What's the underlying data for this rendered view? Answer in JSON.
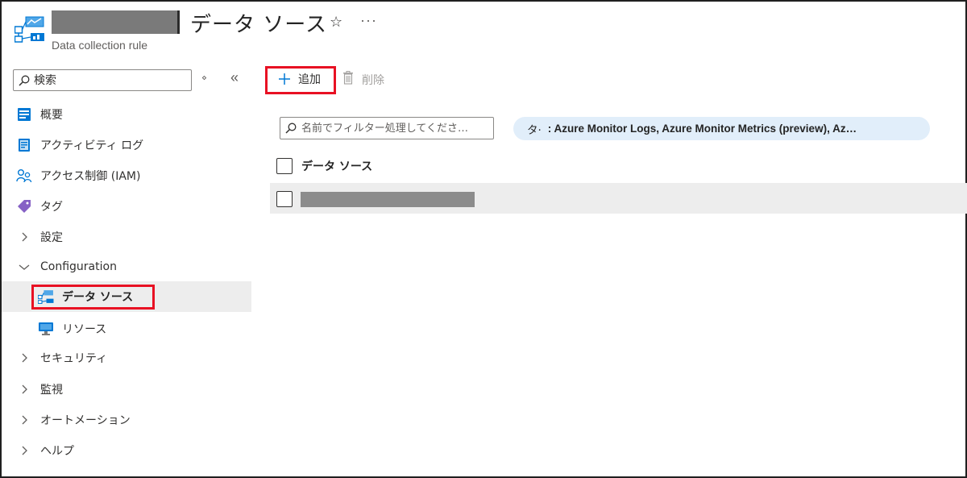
{
  "header": {
    "title": "データ ソース",
    "subtitle": "Data collection rule",
    "star": "☆",
    "more": "···"
  },
  "sidebar": {
    "search_placeholder": "検索",
    "sort_icon": "⋄",
    "collapse_icon": "«",
    "items": [
      {
        "label": "概要",
        "icon": "overview-icon"
      },
      {
        "label": "アクティビティ ログ",
        "icon": "activity-log-icon"
      },
      {
        "label": "アクセス制御 (IAM)",
        "icon": "iam-icon"
      },
      {
        "label": "タグ",
        "icon": "tag-icon"
      },
      {
        "label": "設定",
        "icon": "chevron-right-icon"
      },
      {
        "label": "Configuration",
        "icon": "chevron-down-icon"
      },
      {
        "label": "データ ソース",
        "icon": "data-sources-icon"
      },
      {
        "label": "リソース",
        "icon": "resources-icon"
      },
      {
        "label": "セキュリティ",
        "icon": "chevron-right-icon"
      },
      {
        "label": "監視",
        "icon": "chevron-right-icon"
      },
      {
        "label": "オートメーション",
        "icon": "chevron-right-icon"
      },
      {
        "label": "ヘルプ",
        "icon": "chevron-right-icon"
      }
    ]
  },
  "toolbar": {
    "add_label": "追加",
    "delete_label": "削除"
  },
  "filters": {
    "name_placeholder": "名前でフィルター処理してくださ…",
    "pill_key": "タ·",
    "pill_value": ": Azure Monitor Logs, Azure Monitor Metrics (preview), Az…"
  },
  "grid": {
    "column_header": "データ ソース"
  },
  "colors": {
    "accent": "#0078d4",
    "highlight_border": "#e81123",
    "selected_bg": "#ededed",
    "pill_bg": "#e1eefa"
  }
}
